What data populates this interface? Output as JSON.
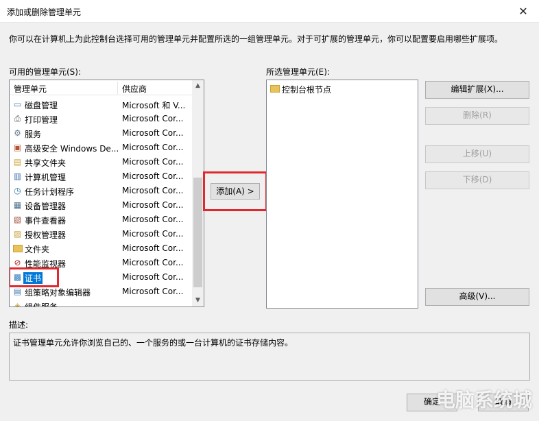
{
  "window": {
    "title": "添加或删除管理单元",
    "close_glyph": "✕"
  },
  "intro_text": "你可以在计算机上为此控制台选择可用的管理单元并配置所选的一组管理单元。对于可扩展的管理单元，你可以配置要启用哪些扩展项。",
  "available": {
    "label": "可用的管理单元(S):",
    "columns": {
      "name": "管理单元",
      "vendor": "供应商"
    },
    "items": [
      {
        "name": "磁盘管理",
        "vendor": "Microsoft 和 V...",
        "icon": "disk-icon"
      },
      {
        "name": "打印管理",
        "vendor": "Microsoft Cor...",
        "icon": "printer-icon"
      },
      {
        "name": "服务",
        "vendor": "Microsoft Cor...",
        "icon": "gear-icon"
      },
      {
        "name": "高级安全 Windows De...",
        "vendor": "Microsoft Cor...",
        "icon": "firewall-icon"
      },
      {
        "name": "共享文件夹",
        "vendor": "Microsoft Cor...",
        "icon": "share-folder-icon"
      },
      {
        "name": "计算机管理",
        "vendor": "Microsoft Cor...",
        "icon": "computer-icon"
      },
      {
        "name": "任务计划程序",
        "vendor": "Microsoft Cor...",
        "icon": "clock-icon"
      },
      {
        "name": "设备管理器",
        "vendor": "Microsoft Cor...",
        "icon": "device-icon"
      },
      {
        "name": "事件查看器",
        "vendor": "Microsoft Cor...",
        "icon": "event-icon"
      },
      {
        "name": "授权管理器",
        "vendor": "Microsoft Cor...",
        "icon": "auth-icon"
      },
      {
        "name": "文件夹",
        "vendor": "Microsoft Cor...",
        "icon": "folder-icon"
      },
      {
        "name": "性能监视器",
        "vendor": "Microsoft Cor...",
        "icon": "perf-icon"
      },
      {
        "name": "证书",
        "vendor": "Microsoft Cor...",
        "icon": "certificate-icon",
        "selected": true
      },
      {
        "name": "组策略对象编辑器",
        "vendor": "Microsoft Cor...",
        "icon": "policy-icon"
      },
      {
        "name": "组件服务",
        "vendor": "",
        "icon": "component-icon"
      }
    ]
  },
  "selected_list": {
    "label": "所选管理单元(E):",
    "root": "控制台根节点"
  },
  "buttons": {
    "add": "添加(A) >",
    "edit_ext": "编辑扩展(X)...",
    "remove": "删除(R)",
    "move_up": "上移(U)",
    "move_down": "下移(D)",
    "advanced": "高级(V)...",
    "ok": "确定",
    "cancel": "取消"
  },
  "description": {
    "label": "描述:",
    "text": "证书管理单元允许你浏览自己的、一个服务的或一台计算机的证书存储内容。"
  },
  "watermark": "电脑系统城",
  "colors": {
    "selection": "#0078d7",
    "highlight": "#e0292f"
  }
}
